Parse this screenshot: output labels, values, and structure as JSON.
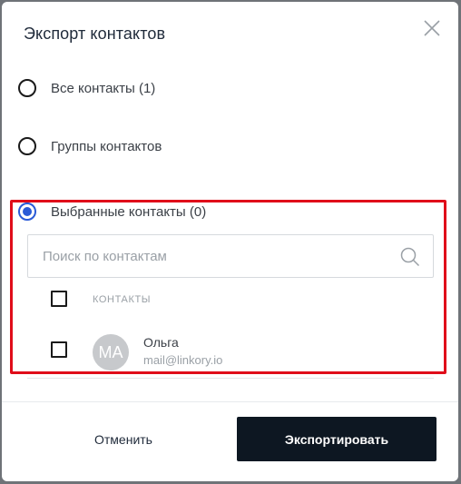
{
  "dialog": {
    "title": "Экспорт контактов",
    "close_icon": "close-icon"
  },
  "options": [
    {
      "label": "Все контакты (1)",
      "selected": false
    },
    {
      "label": "Группы контактов",
      "selected": false
    },
    {
      "label": "Выбранные контакты (0)",
      "selected": true
    }
  ],
  "search": {
    "placeholder": "Поиск по контактам",
    "value": "",
    "icon": "search-icon"
  },
  "table": {
    "header": "КОНТАКТЫ",
    "rows": [
      {
        "initials": "MA",
        "name": "Ольга",
        "email": "mail@linkory.io",
        "checked": false
      }
    ]
  },
  "footer": {
    "cancel_label": "Отменить",
    "export_label": "Экспортировать"
  },
  "colors": {
    "accent": "#2a5bd7",
    "highlight": "#e00d1a",
    "primary_button": "#0d1722"
  }
}
